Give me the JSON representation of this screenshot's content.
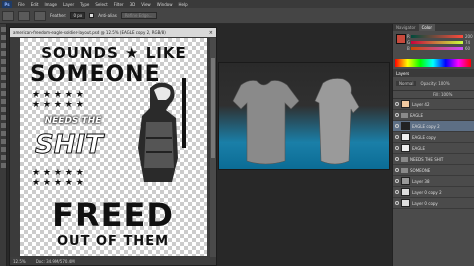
{
  "menu": [
    "File",
    "Edit",
    "Image",
    "Layer",
    "Type",
    "Select",
    "Filter",
    "3D",
    "View",
    "Window",
    "Help"
  ],
  "app_logo": "Ps",
  "options": {
    "feather_label": "Feather:",
    "feather_value": "0 px",
    "antialias_label": "Anti-alias",
    "refine_button": "Refine Edge..."
  },
  "document": {
    "title": "american-freedom-eagle-soldier-layout.psd @ 12.5% (EAGLE copy 2, RGB/8)",
    "zoom": "12.5%",
    "doc_size": "Doc: 34.9M/570.4M"
  },
  "design": {
    "line1": "SOUNDS",
    "line1b": "LIKE",
    "line2": "SOMEONE",
    "line3": "NEEDS THE",
    "line4": "SHIT",
    "line5": "FREED",
    "line6": "OUT OF THEM"
  },
  "panels": {
    "color_tabs": [
      "Navigator",
      "Color"
    ],
    "color_sliders": [
      {
        "label": "R",
        "value": "200"
      },
      {
        "label": "G",
        "value": "74"
      },
      {
        "label": "B",
        "value": "60"
      }
    ],
    "layers_title": "Layers",
    "blend_mode": "Normal",
    "opacity": "Opacity: 100%",
    "fill": "Fill: 100%",
    "layers": [
      {
        "name": "Layer 42",
        "type": "layer",
        "selected": false
      },
      {
        "name": "EAGLE",
        "type": "group",
        "selected": false
      },
      {
        "name": "EAGLE copy 2",
        "type": "layer",
        "selected": true
      },
      {
        "name": "EAGLE copy",
        "type": "layer",
        "selected": false
      },
      {
        "name": "EAGLE",
        "type": "layer",
        "selected": false
      },
      {
        "name": "NEEDS THE SHIT",
        "type": "group",
        "selected": false
      },
      {
        "name": "SOMEONE",
        "type": "group",
        "selected": false
      },
      {
        "name": "Layer 38",
        "type": "layer",
        "selected": false
      },
      {
        "name": "Layer 0 copy 2",
        "type": "layer",
        "selected": false
      },
      {
        "name": "Layer 0 copy",
        "type": "layer",
        "selected": false
      }
    ]
  }
}
